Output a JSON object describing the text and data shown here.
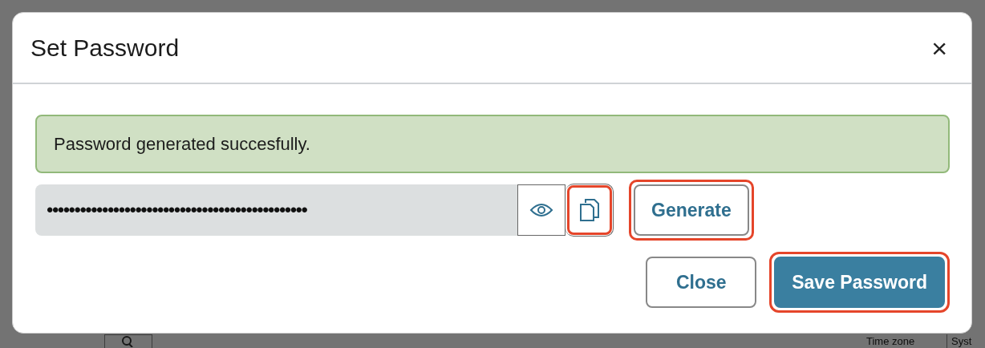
{
  "background": {
    "labels": [
      "Time zone",
      "Syst"
    ]
  },
  "dialog": {
    "title": "Set Password",
    "close_icon": "×",
    "alert": {
      "text": "Password generated succesfully."
    },
    "password": {
      "value": "•••••••••••••••••••••••••••••••••••••••••••••••"
    },
    "tools": [
      {
        "kind": "reveal",
        "highlighted": false
      },
      {
        "kind": "copy",
        "highlighted": true
      }
    ],
    "generate": {
      "label": "Generate",
      "highlighted": true
    },
    "buttons": [
      {
        "label": "Close",
        "kind": "secondary",
        "highlighted": false
      },
      {
        "label": "Save Password",
        "kind": "primary",
        "highlighted": true
      }
    ]
  }
}
